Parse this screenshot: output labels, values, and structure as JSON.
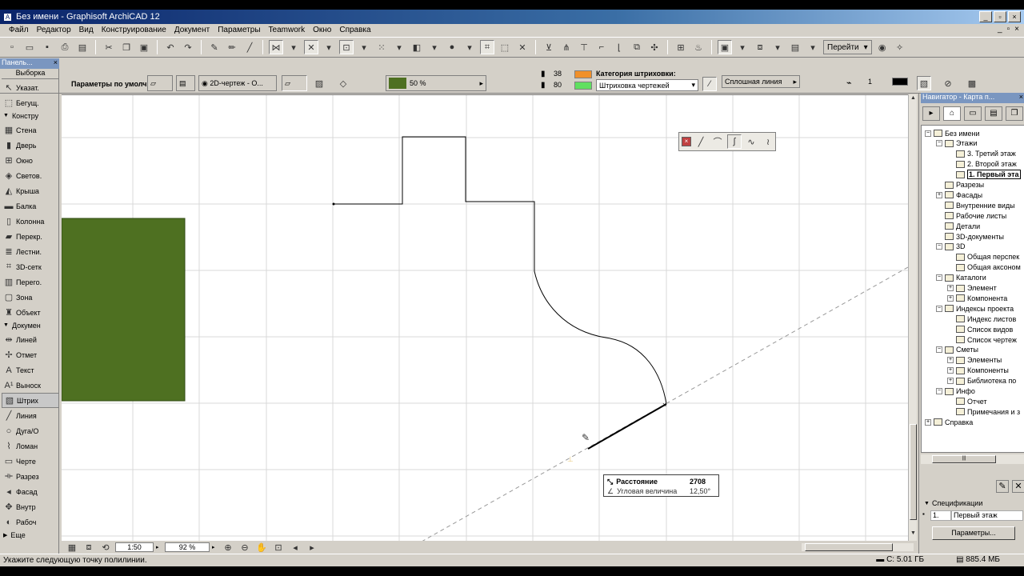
{
  "window": {
    "title": "Без имени - Graphisoft ArchiCAD 12",
    "buttons": [
      "_",
      "▫",
      "×"
    ]
  },
  "menubar": {
    "items": [
      "Файл",
      "Редактор",
      "Вид",
      "Конструирование",
      "Документ",
      "Параметры",
      "Teamwork",
      "Окно",
      "Справка"
    ],
    "window_controls": [
      "_",
      "▫",
      "×"
    ]
  },
  "toolbar": {
    "goto_label": "Перейти"
  },
  "infobox": {
    "panel_title": "Панель...",
    "defaults_label": "Параметры по умолч.",
    "view_dropdown": "2D-чертеж - О...",
    "fill_percent": "50 %",
    "fill_color": "#4e7021",
    "pen1": "38",
    "pen2": "80",
    "hatch_category_label": "Категория штриховки:",
    "hatch_category": "Штриховка чертежей",
    "line_type": "Сплошная линия",
    "pen_count": "1"
  },
  "toolbox": {
    "select_label": "Выборка",
    "tools": [
      {
        "label": "Указат.",
        "icon": "arrow-cursor-icon"
      },
      {
        "label": "Бегущ.",
        "icon": "marquee-icon"
      }
    ],
    "group_construct": "Констру",
    "construct_tools": [
      {
        "label": "Стена",
        "icon": "wall-icon"
      },
      {
        "label": "Дверь",
        "icon": "door-icon"
      },
      {
        "label": "Окно",
        "icon": "window-icon"
      },
      {
        "label": "Светов.",
        "icon": "skylight-icon"
      },
      {
        "label": "Крыша",
        "icon": "roof-icon"
      },
      {
        "label": "Балка",
        "icon": "beam-icon"
      },
      {
        "label": "Колонна",
        "icon": "column-icon"
      },
      {
        "label": "Перекр.",
        "icon": "slab-icon"
      },
      {
        "label": "Лестни.",
        "icon": "stair-icon"
      },
      {
        "label": "3D-сетк",
        "icon": "mesh-icon"
      },
      {
        "label": "Перего.",
        "icon": "curtain-wall-icon"
      },
      {
        "label": "Зона",
        "icon": "zone-icon"
      },
      {
        "label": "Объект",
        "icon": "object-icon"
      }
    ],
    "group_document": "Докумен",
    "document_tools": [
      {
        "label": "Линей",
        "icon": "dimension-icon"
      },
      {
        "label": "Отмет",
        "icon": "level-dimension-icon"
      },
      {
        "label": "Текст",
        "icon": "text-icon"
      },
      {
        "label": "Выноск",
        "icon": "label-icon"
      },
      {
        "label": "Штрих",
        "icon": "fill-icon"
      },
      {
        "label": "Линия",
        "icon": "line-icon"
      },
      {
        "label": "Дуга/О",
        "icon": "arc-icon"
      },
      {
        "label": "Ломан",
        "icon": "polyline-icon"
      },
      {
        "label": "Черте",
        "icon": "drawing-icon"
      },
      {
        "label": "Разрез",
        "icon": "section-icon"
      },
      {
        "label": "Фасад",
        "icon": "elevation-icon"
      },
      {
        "label": "Внутр",
        "icon": "interior-elevation-icon"
      },
      {
        "label": "Рабоч",
        "icon": "worksheet-icon"
      }
    ],
    "more_label": "Еще"
  },
  "canvas": {
    "tracker": {
      "distance_label": "Расстояние",
      "distance_value": "2708",
      "angle_label": "Угловая величина",
      "angle_value": "12,50°"
    },
    "fill_color": "#4e7021"
  },
  "bottombar": {
    "scale": "1:50",
    "zoom": "92 %"
  },
  "statusbar": {
    "prompt": "Укажите следующую точку полилинии.",
    "disk": "C: 5.01 ГБ",
    "memory": "885.4 МБ"
  },
  "navigator": {
    "title": "Навигатор - Карта п...",
    "tree": [
      {
        "label": "Без имени",
        "level": 0,
        "pm": "−"
      },
      {
        "label": "Этажи",
        "level": 1,
        "pm": "−"
      },
      {
        "label": "3. Третий этаж",
        "level": 2,
        "pm": ""
      },
      {
        "label": "2. Второй этаж",
        "level": 2,
        "pm": ""
      },
      {
        "label": "1. Первый эта",
        "level": 2,
        "pm": "",
        "bold": true
      },
      {
        "label": "Разрезы",
        "level": 1,
        "pm": ""
      },
      {
        "label": "Фасады",
        "level": 1,
        "pm": "+"
      },
      {
        "label": "Внутренние виды",
        "level": 1,
        "pm": ""
      },
      {
        "label": "Рабочие листы",
        "level": 1,
        "pm": ""
      },
      {
        "label": "Детали",
        "level": 1,
        "pm": ""
      },
      {
        "label": "3D-документы",
        "level": 1,
        "pm": ""
      },
      {
        "label": "3D",
        "level": 1,
        "pm": "−"
      },
      {
        "label": "Общая перспек",
        "level": 2,
        "pm": ""
      },
      {
        "label": "Общая аксоном",
        "level": 2,
        "pm": ""
      },
      {
        "label": "Каталоги",
        "level": 1,
        "pm": "−"
      },
      {
        "label": "Элемент",
        "level": 2,
        "pm": "+"
      },
      {
        "label": "Компонента",
        "level": 2,
        "pm": "+"
      },
      {
        "label": "Индексы проекта",
        "level": 1,
        "pm": "−"
      },
      {
        "label": "Индекс листов",
        "level": 2,
        "pm": ""
      },
      {
        "label": "Список видов",
        "level": 2,
        "pm": ""
      },
      {
        "label": "Список чертеж",
        "level": 2,
        "pm": ""
      },
      {
        "label": "Сметы",
        "level": 1,
        "pm": "−"
      },
      {
        "label": "Элементы",
        "level": 2,
        "pm": "+"
      },
      {
        "label": "Компоненты",
        "level": 2,
        "pm": "+"
      },
      {
        "label": "Библиотека по",
        "level": 2,
        "pm": "+"
      },
      {
        "label": "Инфо",
        "level": 1,
        "pm": "−"
      },
      {
        "label": "Отчет",
        "level": 2,
        "pm": ""
      },
      {
        "label": "Примечания и з",
        "level": 2,
        "pm": ""
      },
      {
        "label": "Справка",
        "level": 0,
        "pm": "+"
      }
    ],
    "spec_title": "Спецификации",
    "spec_index": "1.",
    "spec_value": "Первый этаж",
    "params_button": "Параметры..."
  }
}
